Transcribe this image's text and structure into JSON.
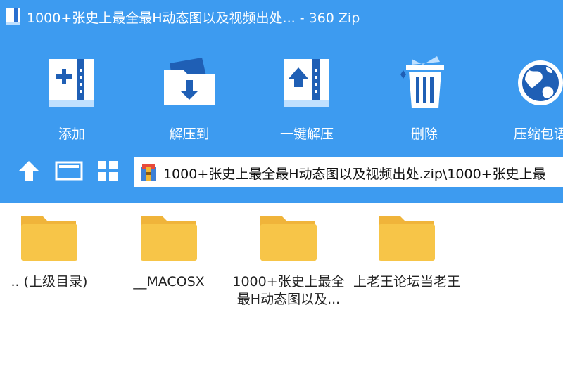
{
  "window": {
    "title": "1000+张史上最全最H动态图以及视频出处... - 360 Zip"
  },
  "toolbar": {
    "items": [
      {
        "label": "添加",
        "icon": "add-archive-icon"
      },
      {
        "label": "解压到",
        "icon": "extract-to-icon"
      },
      {
        "label": "一键解压",
        "icon": "one-click-extract-icon"
      },
      {
        "label": "删除",
        "icon": "trash-icon"
      },
      {
        "label": "压缩包语",
        "icon": "globe-icon"
      }
    ]
  },
  "nav": {
    "up_icon": "up-arrow-icon",
    "details_view_icon": "details-view-icon",
    "grid_view_icon": "grid-view-icon"
  },
  "path": {
    "icon": "zip-archive-icon",
    "value": "1000+张史上最全最H动态图以及视频出处.zip\\1000+张史上最"
  },
  "files": [
    {
      "line1": ".. (上级目录)",
      "line2": ""
    },
    {
      "line1": "__MACOSX",
      "line2": ""
    },
    {
      "line1": "1000+张史上最全",
      "line2": "最H动态图以及..."
    },
    {
      "line1": "上老王论坛当老王",
      "line2": ""
    }
  ],
  "colors": {
    "accent": "#3d9bf0",
    "folder": "#f7c548",
    "icon_dark_blue": "#1f5fb5"
  }
}
